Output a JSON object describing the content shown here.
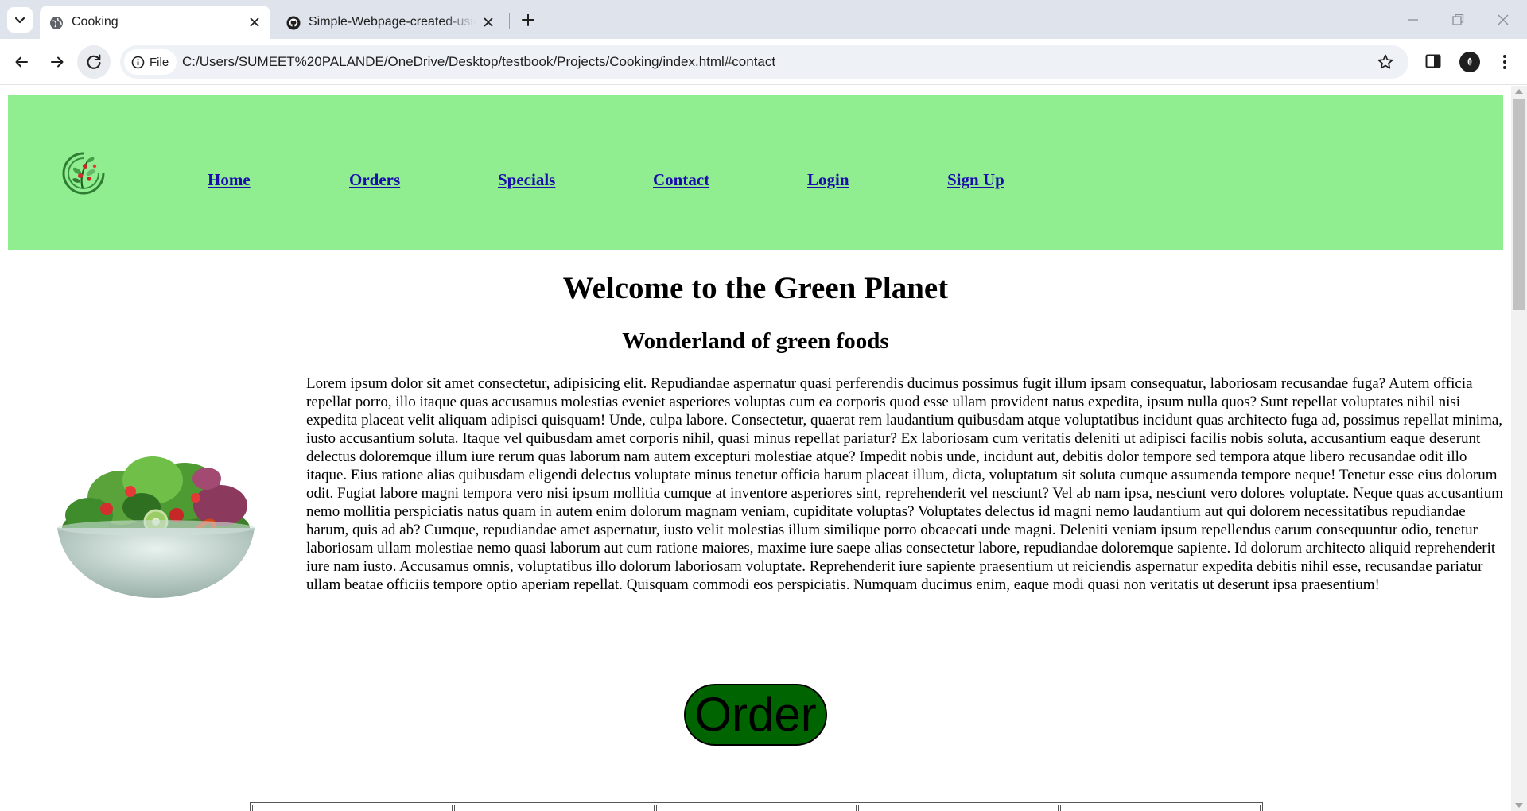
{
  "browser": {
    "tabs": [
      {
        "title": "Cooking",
        "active": true,
        "favicon": "globe-icon"
      },
      {
        "title": "Simple-Webpage-created-using-HTML",
        "active": false,
        "favicon": "github-icon"
      }
    ],
    "site_chip_label": "File",
    "url": "C:/Users/SUMEET%20PALANDE/OneDrive/Desktop/testbook/Projects/Cooking/index.html#contact"
  },
  "page": {
    "header_bg": "#90ee90",
    "nav": [
      {
        "label": "Home"
      },
      {
        "label": "Orders"
      },
      {
        "label": "Specials"
      },
      {
        "label": "Contact"
      },
      {
        "label": "Login"
      },
      {
        "label": "Sign Up"
      }
    ],
    "title": "Welcome to the Green Planet",
    "subtitle": "Wonderland of green foods",
    "body_text": "Lorem ipsum dolor sit amet consectetur, adipisicing elit. Repudiandae aspernatur quasi perferendis ducimus possimus fugit illum ipsam consequatur, laboriosam recusandae fuga? Autem officia repellat porro, illo itaque quas accusamus molestias eveniet asperiores voluptas cum ea corporis quod esse ullam provident natus expedita, ipsum nulla quos? Sunt repellat voluptates nihil nisi expedita placeat velit aliquam adipisci quisquam! Unde, culpa labore. Consectetur, quaerat rem laudantium quibusdam atque voluptatibus incidunt quas architecto fuga ad, possimus repellat minima, iusto accusantium soluta. Itaque vel quibusdam amet corporis nihil, quasi minus repellat pariatur? Ex laboriosam cum veritatis deleniti ut adipisci facilis nobis soluta, accusantium eaque deserunt delectus doloremque illum iure rerum quas laborum nam autem excepturi molestiae atque? Impedit nobis unde, incidunt aut, debitis dolor tempore sed tempora atque libero recusandae odit illo itaque. Eius ratione alias quibusdam eligendi delectus voluptate minus tenetur officia harum placeat illum, dicta, voluptatum sit soluta cumque assumenda tempore neque! Tenetur esse eius dolorum odit. Fugiat labore magni tempora vero nisi ipsum mollitia cumque at inventore asperiores sint, reprehenderit vel nesciunt? Vel ab nam ipsa, nesciunt vero dolores voluptate. Neque quas accusantium nemo mollitia perspiciatis natus quam in autem enim dolorum magnam veniam, cupiditate voluptas? Voluptates delectus id magni nemo laudantium aut qui dolorem necessitatibus repudiandae harum, quis ad ab? Cumque, repudiandae amet aspernatur, iusto velit molestias illum similique porro obcaecati unde magni. Deleniti veniam ipsum repellendus earum consequuntur odio, tenetur laboriosam ullam molestiae nemo quasi laborum aut cum ratione maiores, maxime iure saepe alias consectetur labore, repudiandae doloremque sapiente. Id dolorum architecto aliquid reprehenderit iure nam iusto. Accusamus omnis, voluptatibus illo dolorum laboriosam voluptate. Reprehenderit iure sapiente praesentium ut reiciendis aspernatur expedita debitis nihil esse, recusandae pariatur ullam beatae officiis tempore optio aperiam repellat. Quisquam commodi eos perspiciatis. Numquam ducimus enim, eaque modi quasi non veritatis ut deserunt ipsa praesentium!",
    "order_button_label": "Order",
    "order_button_color": "#006400"
  }
}
